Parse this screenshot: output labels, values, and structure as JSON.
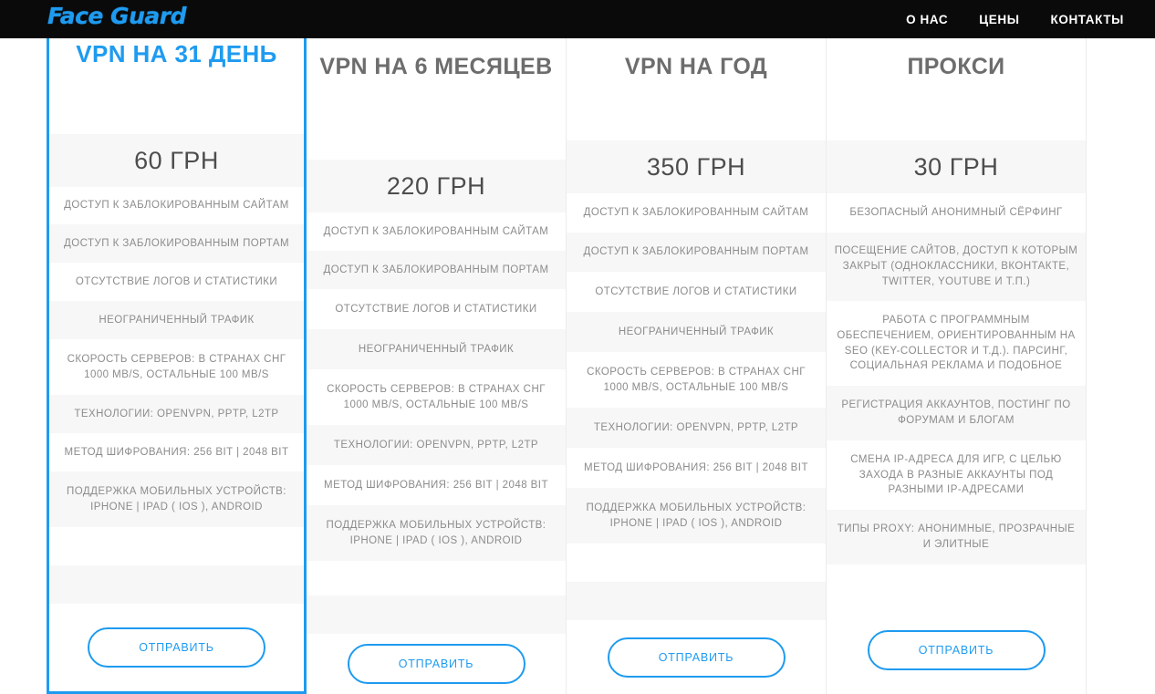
{
  "header": {
    "brand": "Face Guard",
    "nav": [
      {
        "label": "О НАС"
      },
      {
        "label": "ЦЕНЫ"
      },
      {
        "label": "КОНТАКТЫ"
      }
    ]
  },
  "accent_color": "#1e9bf0",
  "plans": [
    {
      "title": "VPN НА 31 ДЕНЬ",
      "price": "60 ГРН",
      "featured": true,
      "button": "ОТПРАВИТЬ",
      "features": [
        "ДОСТУП К ЗАБЛОКИРОВАННЫМ САЙТАМ",
        "ДОСТУП К ЗАБЛОКИРОВАННЫМ ПОРТАМ",
        "ОТСУТСТВИЕ ЛОГОВ И СТАТИСТИКИ",
        "НЕОГРАНИЧЕННЫЙ ТРАФИК",
        "СКОРОСТЬ СЕРВЕРОВ: В СТРАНАХ СНГ 1000 MB/S, ОСТАЛЬНЫЕ 100 MB/S",
        "ТЕХНОЛОГИИ: OPENVPN, PPTP, L2TP",
        "МЕТОД ШИФРОВАНИЯ: 256 BIT | 2048 BIT",
        "ПОДДЕРЖКА МОБИЛЬНЫХ УСТРОЙСТВ: IPHONE | IPAD ( IOS ), ANDROID"
      ]
    },
    {
      "title": "VPN НА 6 МЕСЯЦЕВ",
      "price": "220 ГРН",
      "featured": false,
      "button": "ОТПРАВИТЬ",
      "features": [
        "ДОСТУП К ЗАБЛОКИРОВАННЫМ САЙТАМ",
        "ДОСТУП К ЗАБЛОКИРОВАННЫМ ПОРТАМ",
        "ОТСУТСТВИЕ ЛОГОВ И СТАТИСТИКИ",
        "НЕОГРАНИЧЕННЫЙ ТРАФИК",
        "СКОРОСТЬ СЕРВЕРОВ: В СТРАНАХ СНГ 1000 MB/S, ОСТАЛЬНЫЕ 100 MB/S",
        "ТЕХНОЛОГИИ: OPENVPN, PPTP, L2TP",
        "МЕТОД ШИФРОВАНИЯ: 256 BIT | 2048 BIT",
        "ПОДДЕРЖКА МОБИЛЬНЫХ УСТРОЙСТВ: IPHONE | IPAD ( IOS ), ANDROID"
      ]
    },
    {
      "title": "VPN НА ГОД",
      "price": "350 ГРН",
      "featured": false,
      "button": "ОТПРАВИТЬ",
      "features": [
        "ДОСТУП К ЗАБЛОКИРОВАННЫМ САЙТАМ",
        "ДОСТУП К ЗАБЛОКИРОВАННЫМ ПОРТАМ",
        "ОТСУТСТВИЕ ЛОГОВ И СТАТИСТИКИ",
        "НЕОГРАНИЧЕННЫЙ ТРАФИК",
        "СКОРОСТЬ СЕРВЕРОВ: В СТРАНАХ СНГ 1000 MB/S, ОСТАЛЬНЫЕ 100 MB/S",
        "ТЕХНОЛОГИИ: OPENVPN, PPTP, L2TP",
        "МЕТОД ШИФРОВАНИЯ: 256 BIT | 2048 BIT",
        "ПОДДЕРЖКА МОБИЛЬНЫХ УСТРОЙСТВ: IPHONE | IPAD ( IOS ), ANDROID"
      ]
    },
    {
      "title": "ПРОКСИ",
      "price": "30 ГРН",
      "featured": false,
      "button": "ОТПРАВИТЬ",
      "features": [
        "БЕЗОПАСНЫЙ АНОНИМНЫЙ СЁРФИНГ",
        "ПОСЕЩЕНИЕ САЙТОВ, ДОСТУП К КОТОРЫМ ЗАКРЫТ (ОДНОКЛАССНИКИ, ВКОНТАКТЕ, TWITTER, YOUTUBE И Т.П.)",
        "РАБОТА С ПРОГРАММНЫМ ОБЕСПЕЧЕНИЕМ, ОРИЕНТИРОВАННЫМ НА SEO (KEY-COLLECTOR И Т.Д.). ПАРСИНГ, СОЦИАЛЬНАЯ РЕКЛАМА И ПОДОБНОЕ",
        "РЕГИСТРАЦИЯ АККАУНТОВ, ПОСТИНГ ПО ФОРУМАМ И БЛОГАМ",
        "СМЕНА IP-АДРЕСА ДЛЯ ИГР, С ЦЕЛЬЮ ЗАХОДА В РАЗНЫЕ АККАУНТЫ ПОД РАЗНЫМИ IP-АДРЕСАМИ",
        "ТИПЫ PROXY: АНОНИМНЫЕ, ПРОЗРАЧНЫЕ И ЭЛИТНЫЕ"
      ]
    }
  ]
}
